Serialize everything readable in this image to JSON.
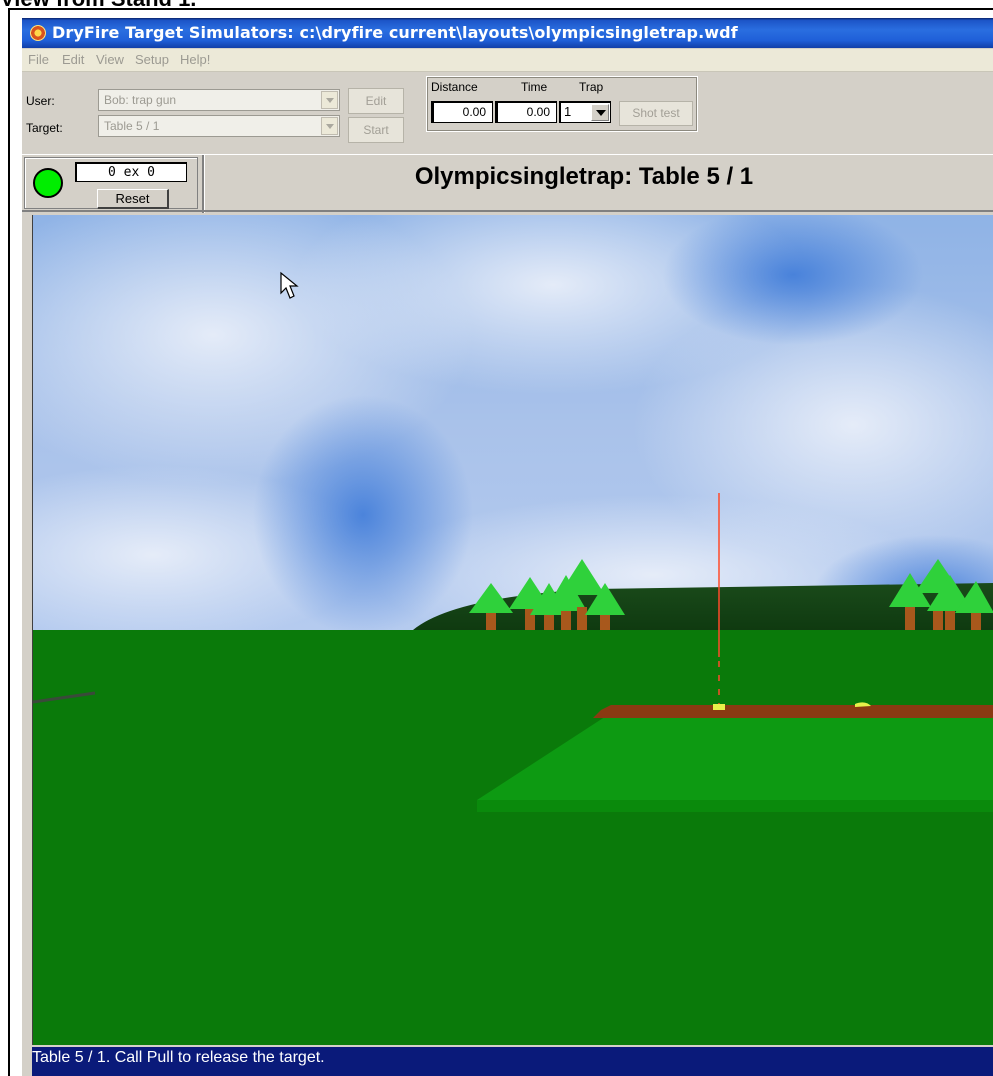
{
  "page_caption": "View from Stand 1.",
  "window": {
    "title": "DryFire Target Simulators: c:\\dryfire current\\layouts\\olympicsingletrap.wdf"
  },
  "menu": [
    "File",
    "Edit",
    "View",
    "Setup",
    "Help!"
  ],
  "controls": {
    "user_label": "User:",
    "user_value": "Bob: trap gun",
    "target_label": "Target:",
    "target_value": "Table 5 / 1",
    "edit_button": "Edit",
    "start_button": "Start",
    "distance_label": "Distance",
    "time_label": "Time",
    "trap_label": "Trap",
    "distance_value": "0.00",
    "time_value": "0.00",
    "trap_value": "1",
    "shot_test_button": "Shot test"
  },
  "score": {
    "text": "0 ex 0",
    "reset_label": "Reset",
    "light_color": "#00ee00"
  },
  "scene_title": "Olympicsingletrap: Table 5 / 1",
  "status_text": "Table 5 / 1.  Call Pull to release the target.",
  "colors": {
    "title_bar": "#1f5fd8",
    "status_bar": "#0a1a7a",
    "grass": "#0a7a0a",
    "sky": "#7ea8e0",
    "dirt_strip": "#8a3a12"
  }
}
